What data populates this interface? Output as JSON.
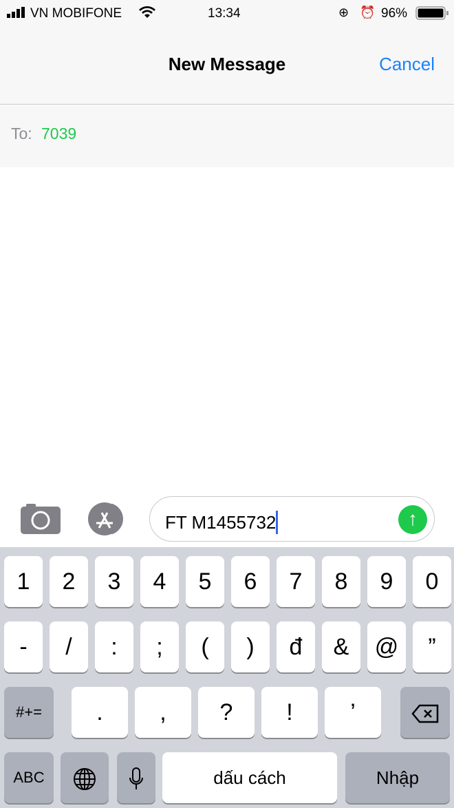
{
  "status": {
    "carrier": "VN MOBIFONE",
    "time": "13:34",
    "battery": "96%"
  },
  "nav": {
    "title": "New Message",
    "cancel": "Cancel"
  },
  "to": {
    "label": "To:",
    "recipient": "7039"
  },
  "composer": {
    "text": "FT M1455732"
  },
  "keyboard": {
    "row1": [
      "1",
      "2",
      "3",
      "4",
      "5",
      "6",
      "7",
      "8",
      "9",
      "0"
    ],
    "row2": [
      "-",
      "/",
      ":",
      ";",
      "(",
      ")",
      "đ",
      "&",
      "@",
      "”"
    ],
    "row3": [
      ".",
      ",",
      "?",
      "!",
      "’"
    ],
    "symbols": "#+=",
    "abc": "ABC",
    "space": "dấu cách",
    "return": "Nhập"
  },
  "colors": {
    "accent": "#1a82fb",
    "recipient": "#1ec94c",
    "send": "#1ec94c"
  }
}
